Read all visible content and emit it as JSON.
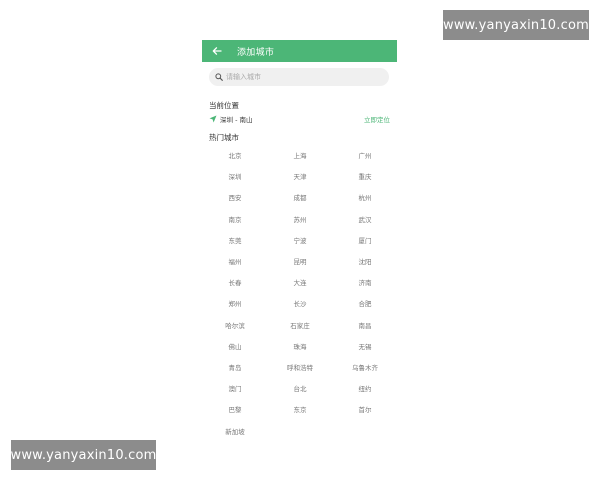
{
  "watermark": {
    "top": "www.yanyaxin10.com",
    "bottom": "www.yanyaxin10.com"
  },
  "header": {
    "title": "添加城市",
    "back_icon": "arrow-left-icon"
  },
  "search": {
    "placeholder": "请输入城市",
    "icon": "search-icon"
  },
  "current_location": {
    "title": "当前位置",
    "value": "深圳 - 南山",
    "icon": "location-arrow-icon",
    "locate_label": "立即定位"
  },
  "hot_cities": {
    "title": "热门城市",
    "items": [
      "北京",
      "上海",
      "广州",
      "深圳",
      "天津",
      "重庆",
      "西安",
      "成都",
      "杭州",
      "南京",
      "苏州",
      "武汉",
      "东莞",
      "宁波",
      "厦门",
      "福州",
      "昆明",
      "沈阳",
      "长春",
      "大连",
      "济南",
      "郑州",
      "长沙",
      "合肥",
      "哈尔滨",
      "石家庄",
      "南昌",
      "佛山",
      "珠海",
      "无锡",
      "青岛",
      "呼和浩特",
      "乌鲁木齐",
      "澳门",
      "台北",
      "纽约",
      "巴黎",
      "东京",
      "首尔",
      "新加坡"
    ]
  },
  "colors": {
    "accent": "#4cb677",
    "search_bg": "#f0f0f0",
    "watermark_bg": "#8c8c8c"
  }
}
